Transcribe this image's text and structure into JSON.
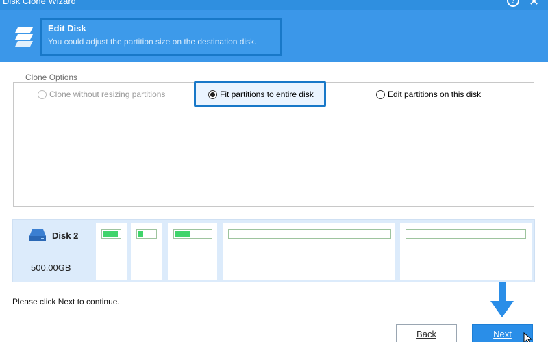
{
  "window": {
    "title": "Disk Clone Wizard",
    "help_icon": "?",
    "close_icon": "✕"
  },
  "header": {
    "title": "Edit Disk",
    "subtitle": "You could adjust the partition size on the destination disk.",
    "icon": "partitions-icon"
  },
  "clone_options": {
    "legend": "Clone Options",
    "options": [
      {
        "label": "Clone without resizing partitions",
        "state": "disabled"
      },
      {
        "label": "Fit partitions to entire disk",
        "state": "selected"
      },
      {
        "label": "Edit partitions on this disk",
        "state": "unselected"
      }
    ]
  },
  "disk": {
    "name": "Disk 2",
    "size": "500.00GB",
    "icon": "disk-drive-icon",
    "partitions": [
      {
        "used_fraction": 0.9
      },
      {
        "used_fraction": 0.35
      },
      {
        "used_fraction": 0.45
      },
      {
        "used_fraction": 0.0
      },
      {
        "used_fraction": 0.0
      }
    ]
  },
  "status_text": "Please click Next to continue.",
  "buttons": {
    "back": "Back",
    "next": "Next"
  },
  "colors": {
    "accent": "#3b97e9",
    "highlight": "#1878c8",
    "used_bar": "#3fd46a",
    "diskmap_bg": "#dcebfb"
  }
}
